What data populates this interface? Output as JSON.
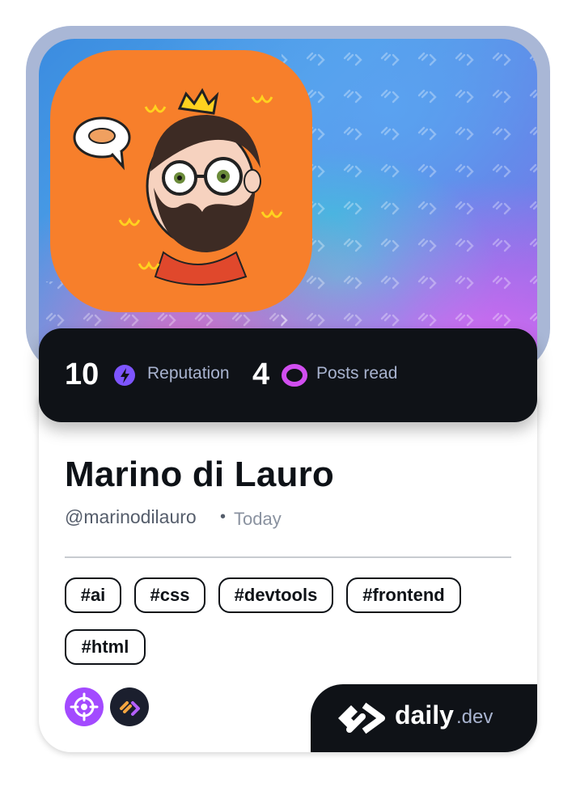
{
  "profile": {
    "name": "Marino di Lauro",
    "handle": "@marinodilauro",
    "separator": "•",
    "date": "Today"
  },
  "stats": {
    "reputation_value": "10",
    "reputation_label": "Reputation",
    "reputation_icon": "lightning-icon",
    "posts_value": "4",
    "posts_label": "Posts read",
    "posts_icon": "eye-ring-icon"
  },
  "tags": [
    "#ai",
    "#css",
    "#devtools",
    "#frontend",
    "#html"
  ],
  "badges": [
    {
      "icon": "crosshair-icon",
      "color": "#a34aff"
    },
    {
      "icon": "daily-dev-icon",
      "color": "#1b1f2e"
    }
  ],
  "brand": {
    "main": "daily",
    "suffix": ".dev"
  },
  "colors": {
    "accent_purple": "#7e55ff",
    "accent_magenta": "#d14ef0",
    "avatar_bg": "#f77f2b",
    "dark": "#0f1217"
  }
}
